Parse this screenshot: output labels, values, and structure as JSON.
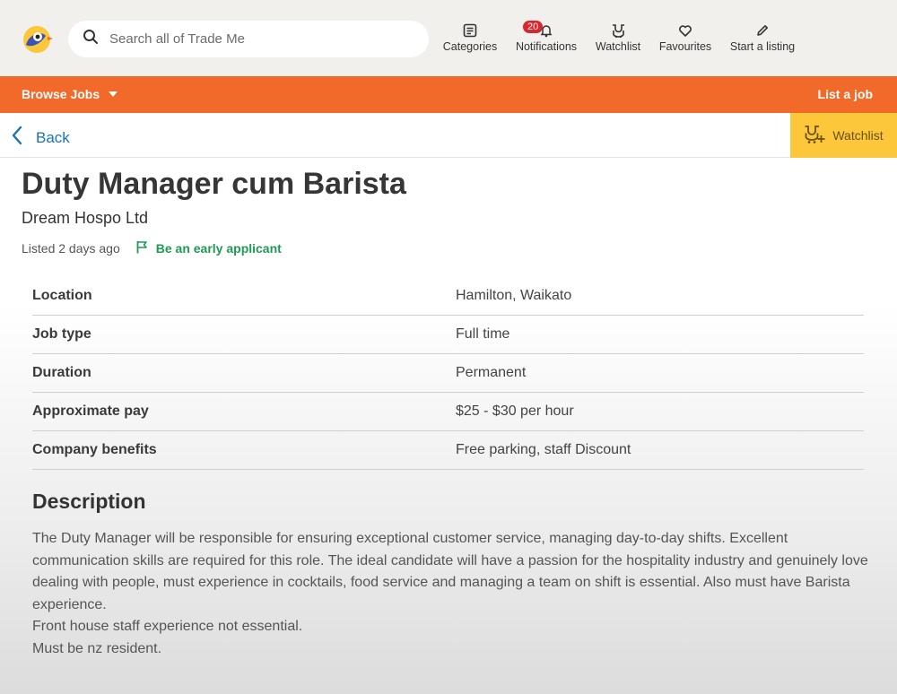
{
  "header": {
    "search_placeholder": "Search all of Trade Me",
    "nav": [
      {
        "icon": "categories-icon",
        "label": "Categories"
      },
      {
        "icon": "bell-icon",
        "label": "Notifications",
        "badge": "20"
      },
      {
        "icon": "watchlist-icon",
        "label": "Watchlist"
      },
      {
        "icon": "heart-icon",
        "label": "Favourites"
      },
      {
        "icon": "pencil-icon",
        "label": "Start a listing"
      }
    ]
  },
  "orangebar": {
    "browse_label": "Browse Jobs",
    "list_label": "List a job"
  },
  "backrow": {
    "back_label": "Back",
    "watchlist_label": "Watchlist"
  },
  "listing": {
    "title": "Duty Manager cum Barista",
    "company": "Dream Hospo Ltd",
    "listed": "Listed 2 days ago",
    "early_label": "Be an early applicant",
    "details": [
      {
        "label": "Location",
        "value": "Hamilton, Waikato"
      },
      {
        "label": "Job type",
        "value": "Full time"
      },
      {
        "label": "Duration",
        "value": "Permanent"
      },
      {
        "label": "Approximate pay",
        "value": "$25 - $30 per hour"
      },
      {
        "label": "Company benefits",
        "value": "Free parking, staff Discount"
      }
    ],
    "description_heading": "Description",
    "description_lines": [
      "The Duty Manager will be responsible for ensuring exceptional customer service, managing day-to-day shifts. Excellent communication skills are required for this role.  The ideal candidate will have a passion for the hospitality industry and genuinely love dealing with people, must experience in cocktails, food service and managing a team on shift is essential. Also must have Barista experience.",
      "Front house staff experience not essential.",
      "Must be nz resident."
    ]
  },
  "colors": {
    "brand_orange": "#f26a2a",
    "watchlist_yellow": "#fcc73a",
    "link_blue": "#1a73b5",
    "early_green": "#1e9a55",
    "badge_red": "#d9262d"
  }
}
